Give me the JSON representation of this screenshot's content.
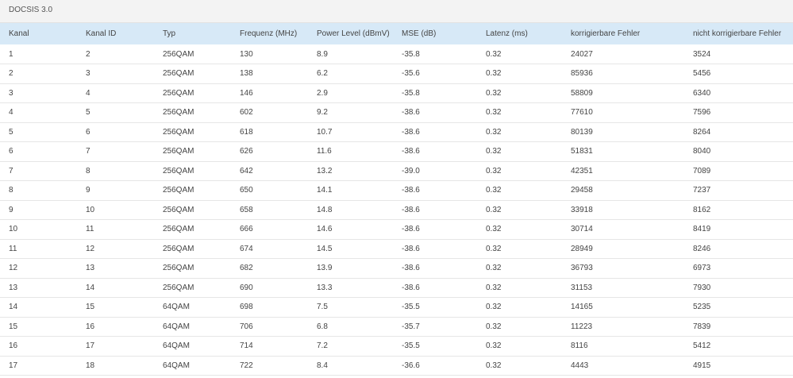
{
  "panel": {
    "title": "DOCSIS 3.0"
  },
  "table": {
    "headers": [
      "Kanal",
      "Kanal ID",
      "Typ",
      "Frequenz (MHz)",
      "Power Level (dBmV)",
      "MSE (dB)",
      "Latenz (ms)",
      "korrigierbare Fehler",
      "nicht korrigierbare Fehler"
    ],
    "rows": [
      [
        "1",
        "2",
        "256QAM",
        "130",
        "8.9",
        "-35.8",
        "0.32",
        "24027",
        "3524"
      ],
      [
        "2",
        "3",
        "256QAM",
        "138",
        "6.2",
        "-35.6",
        "0.32",
        "85936",
        "5456"
      ],
      [
        "3",
        "4",
        "256QAM",
        "146",
        "2.9",
        "-35.8",
        "0.32",
        "58809",
        "6340"
      ],
      [
        "4",
        "5",
        "256QAM",
        "602",
        "9.2",
        "-38.6",
        "0.32",
        "77610",
        "7596"
      ],
      [
        "5",
        "6",
        "256QAM",
        "618",
        "10.7",
        "-38.6",
        "0.32",
        "80139",
        "8264"
      ],
      [
        "6",
        "7",
        "256QAM",
        "626",
        "11.6",
        "-38.6",
        "0.32",
        "51831",
        "8040"
      ],
      [
        "7",
        "8",
        "256QAM",
        "642",
        "13.2",
        "-39.0",
        "0.32",
        "42351",
        "7089"
      ],
      [
        "8",
        "9",
        "256QAM",
        "650",
        "14.1",
        "-38.6",
        "0.32",
        "29458",
        "7237"
      ],
      [
        "9",
        "10",
        "256QAM",
        "658",
        "14.8",
        "-38.6",
        "0.32",
        "33918",
        "8162"
      ],
      [
        "10",
        "11",
        "256QAM",
        "666",
        "14.6",
        "-38.6",
        "0.32",
        "30714",
        "8419"
      ],
      [
        "11",
        "12",
        "256QAM",
        "674",
        "14.5",
        "-38.6",
        "0.32",
        "28949",
        "8246"
      ],
      [
        "12",
        "13",
        "256QAM",
        "682",
        "13.9",
        "-38.6",
        "0.32",
        "36793",
        "6973"
      ],
      [
        "13",
        "14",
        "256QAM",
        "690",
        "13.3",
        "-38.6",
        "0.32",
        "31153",
        "7930"
      ],
      [
        "14",
        "15",
        "64QAM",
        "698",
        "7.5",
        "-35.5",
        "0.32",
        "14165",
        "5235"
      ],
      [
        "15",
        "16",
        "64QAM",
        "706",
        "6.8",
        "-35.7",
        "0.32",
        "11223",
        "7839"
      ],
      [
        "16",
        "17",
        "64QAM",
        "714",
        "7.2",
        "-35.5",
        "0.32",
        "8116",
        "5412"
      ],
      [
        "17",
        "18",
        "64QAM",
        "722",
        "8.4",
        "-36.6",
        "0.32",
        "4443",
        "4915"
      ]
    ]
  }
}
